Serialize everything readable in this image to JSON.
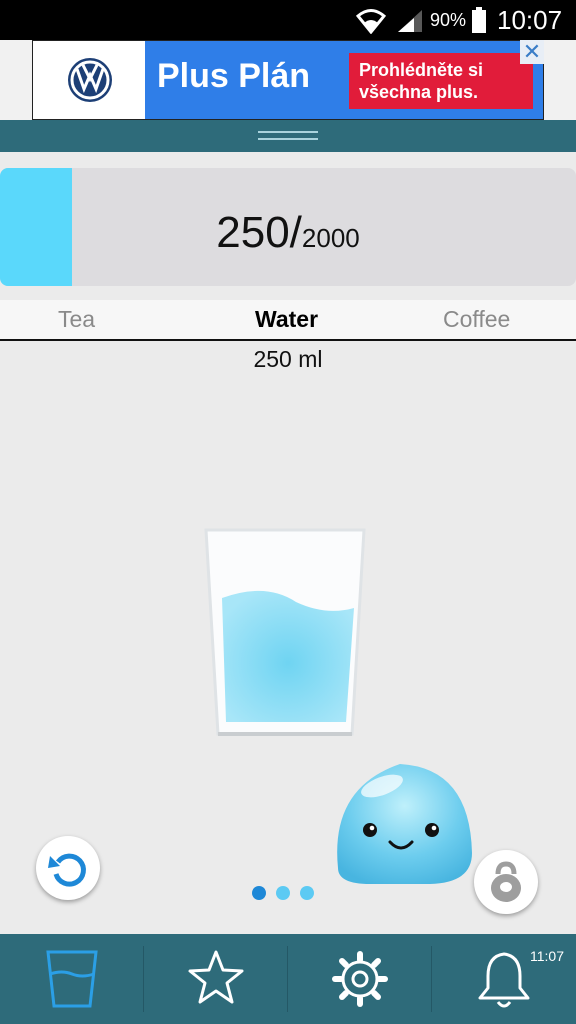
{
  "status_bar": {
    "battery": "90%",
    "time": "10:07",
    "icons": [
      "wifi-icon",
      "signal-icon",
      "battery-icon"
    ]
  },
  "ad": {
    "brand_logo": "vw-logo",
    "title": "Plus Plán",
    "cta": "Prohlédněte si všechna plus.",
    "close": "✕"
  },
  "progress": {
    "current": "250",
    "separator": "/",
    "goal": "2000",
    "fraction": 0.125,
    "fill_color": "#5ad8fb"
  },
  "tabs": [
    {
      "label": "Tea",
      "active": false
    },
    {
      "label": "Water",
      "active": true
    },
    {
      "label": "Coffee",
      "active": false
    }
  ],
  "amount": "250 ml",
  "page_indicator": {
    "count": 3,
    "active": 0
  },
  "bottom_nav": {
    "items": [
      "glass-icon",
      "star-icon",
      "gear-icon",
      "bell-icon"
    ],
    "reminder_time": "11:07",
    "accent": "#2e6b7a",
    "active_color": "#2b9fe6"
  }
}
